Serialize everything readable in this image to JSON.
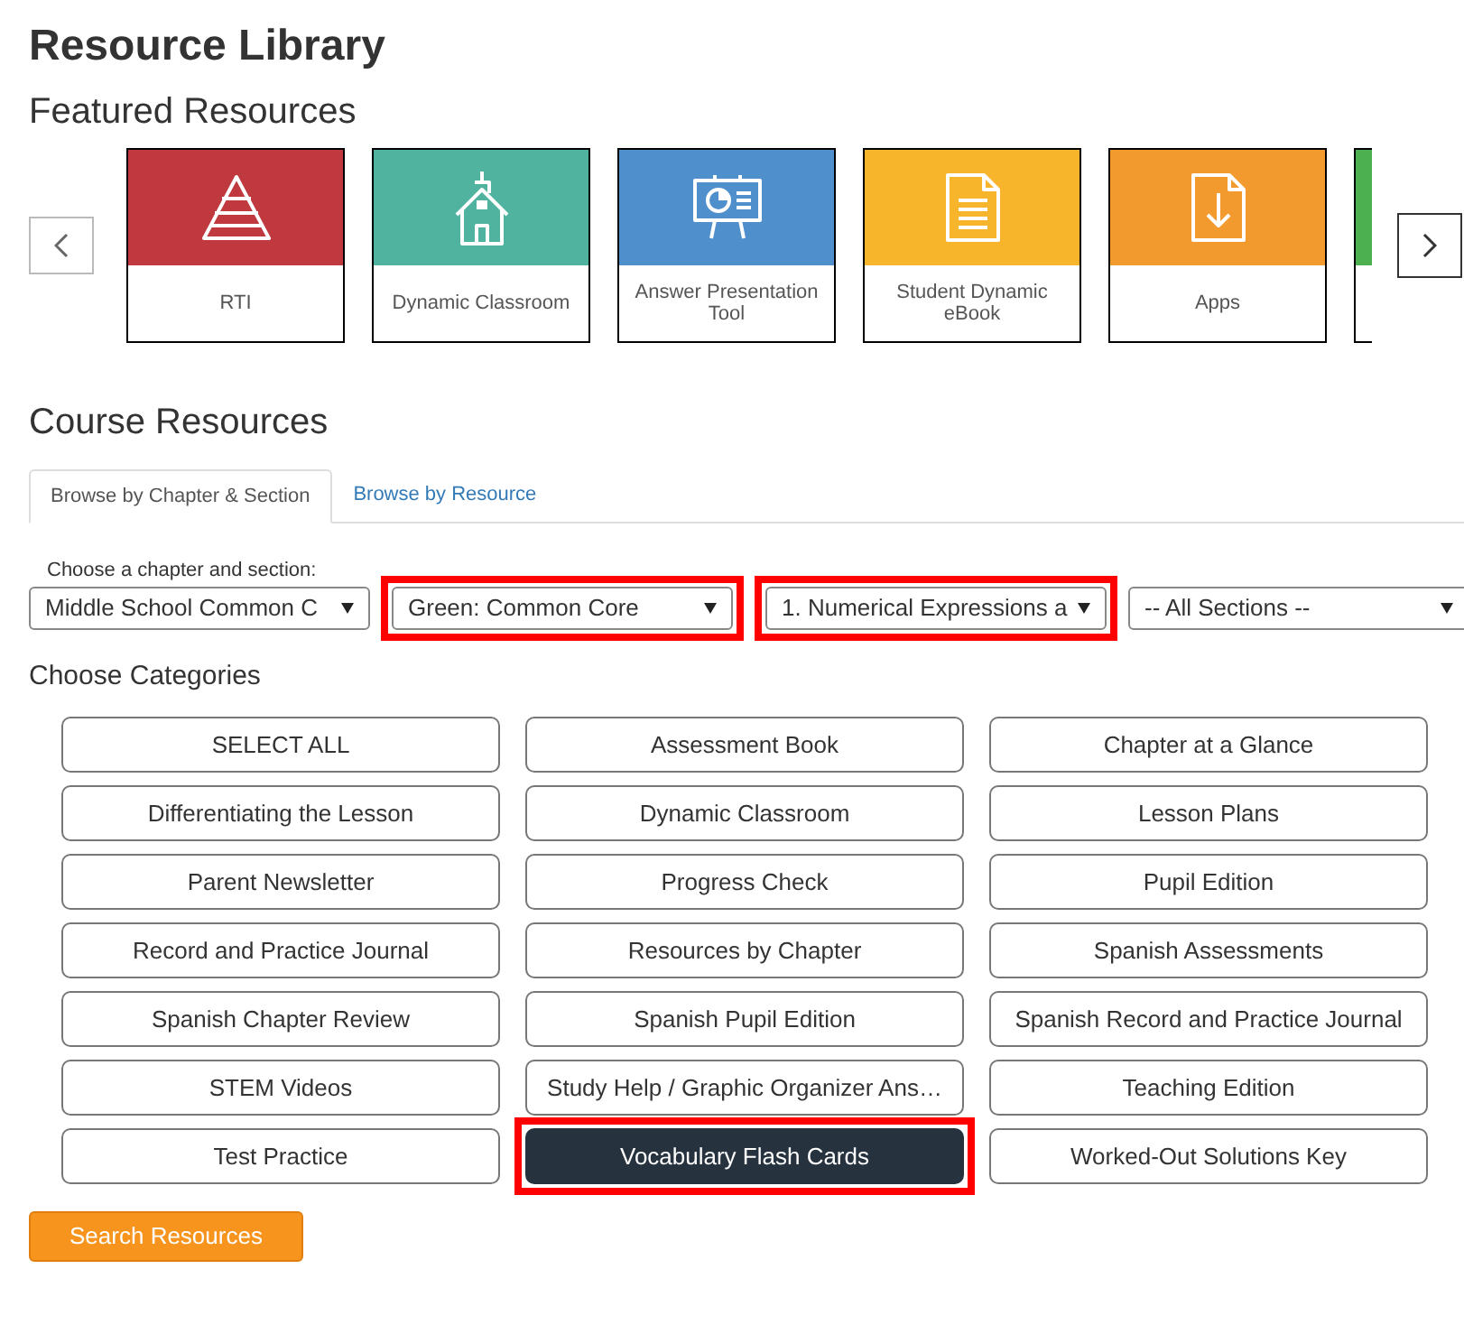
{
  "title": "Resource Library",
  "featured": {
    "heading": "Featured Resources",
    "items": [
      {
        "label": "RTI",
        "color": "#c0393f",
        "kind": "pyramid"
      },
      {
        "label": "Dynamic Classroom",
        "color": "#4fb3a0",
        "kind": "school"
      },
      {
        "label": "Answer Presentation Tool",
        "color": "#4f8fcc",
        "kind": "presentation"
      },
      {
        "label": "Student Dynamic eBook",
        "color": "#f7b52c",
        "kind": "document"
      },
      {
        "label": "Apps",
        "color": "#f39a2f",
        "kind": "download"
      },
      {
        "color": "#4caf50",
        "clipped": true
      }
    ]
  },
  "course": {
    "heading": "Course Resources",
    "tabs": [
      {
        "label": "Browse by Chapter & Section",
        "selected": true
      },
      {
        "label": "Browse by Resource",
        "selected": false
      }
    ],
    "selects_label": "Choose a chapter and section:",
    "selects": [
      {
        "value": "Middle School Common C",
        "highlighted": false
      },
      {
        "value": "Green: Common Core",
        "highlighted": true
      },
      {
        "value": "1. Numerical Expressions a",
        "highlighted": true
      },
      {
        "value": "-- All Sections --",
        "highlighted": false
      }
    ],
    "categories_heading": "Choose Categories",
    "categories": [
      {
        "label": "SELECT ALL",
        "selected": false,
        "highlighted": false
      },
      {
        "label": "Assessment Book",
        "selected": false,
        "highlighted": false
      },
      {
        "label": "Chapter at a Glance",
        "selected": false,
        "highlighted": false
      },
      {
        "label": "Differentiating the Lesson",
        "selected": false,
        "highlighted": false
      },
      {
        "label": "Dynamic Classroom",
        "selected": false,
        "highlighted": false
      },
      {
        "label": "Lesson Plans",
        "selected": false,
        "highlighted": false
      },
      {
        "label": "Parent Newsletter",
        "selected": false,
        "highlighted": false
      },
      {
        "label": "Progress Check",
        "selected": false,
        "highlighted": false
      },
      {
        "label": "Pupil Edition",
        "selected": false,
        "highlighted": false
      },
      {
        "label": "Record and Practice Journal",
        "selected": false,
        "highlighted": false
      },
      {
        "label": "Resources by Chapter",
        "selected": false,
        "highlighted": false
      },
      {
        "label": "Spanish Assessments",
        "selected": false,
        "highlighted": false
      },
      {
        "label": "Spanish Chapter Review",
        "selected": false,
        "highlighted": false
      },
      {
        "label": "Spanish Pupil Edition",
        "selected": false,
        "highlighted": false
      },
      {
        "label": "Spanish Record and Practice Journal",
        "selected": false,
        "highlighted": false
      },
      {
        "label": "STEM Videos",
        "selected": false,
        "highlighted": false
      },
      {
        "label": "Study Help / Graphic Organizer Ans…",
        "selected": false,
        "highlighted": false
      },
      {
        "label": "Teaching Edition",
        "selected": false,
        "highlighted": false
      },
      {
        "label": "Test Practice",
        "selected": false,
        "highlighted": false
      },
      {
        "label": "Vocabulary Flash Cards",
        "selected": true,
        "highlighted": true
      },
      {
        "label": "Worked-Out Solutions Key",
        "selected": false,
        "highlighted": false
      }
    ],
    "search_button": "Search Resources"
  }
}
